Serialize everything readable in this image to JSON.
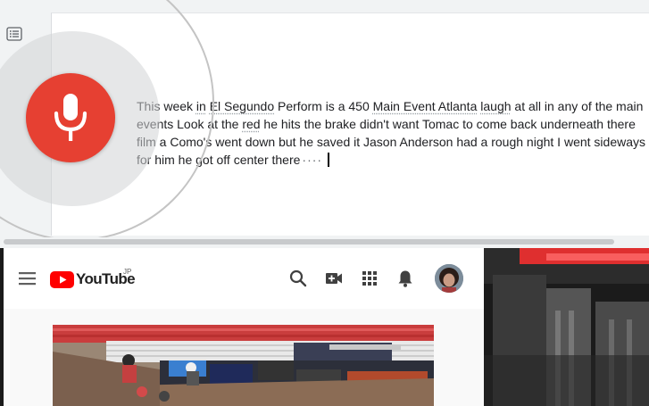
{
  "docs": {
    "transcript_lines": [
      {
        "parts": [
          {
            "text": "This week ",
            "u": false
          },
          {
            "text": "in",
            "u": true
          },
          {
            "text": " ",
            "u": false
          },
          {
            "text": "El Segundo",
            "u": true
          },
          {
            "text": " Perform is a 450 ",
            "u": false
          },
          {
            "text": "Main Event Atlanta",
            "u": true
          },
          {
            "text": " ",
            "u": false
          },
          {
            "text": "laugh",
            "u": true
          },
          {
            "text": " at all in any of the main",
            "u": false
          }
        ]
      },
      {
        "parts": [
          {
            "text": "events Look at the ",
            "u": false
          },
          {
            "text": "red",
            "u": true
          },
          {
            "text": " he hits the brake didn't want Tomac to come back underneath there",
            "u": false
          }
        ]
      },
      {
        "parts": [
          {
            "text": "film a Como's went down but he saved it Jason Anderson had a rough night I went sideways",
            "u": false
          }
        ]
      },
      {
        "parts": [
          {
            "text": "for him he got off center there",
            "u": false
          }
        ]
      }
    ],
    "interim_indicator": "····",
    "icons": {
      "outline": "document-outline-icon",
      "mic": "microphone-icon"
    },
    "colors": {
      "mic_button": "#e64032",
      "page_bg": "#f1f3f4"
    }
  },
  "youtube": {
    "logo_text": "YouTube",
    "region_code": "JP",
    "icons": {
      "menu": "hamburger-menu-icon",
      "search": "search-icon",
      "create": "video-camera-plus-icon",
      "apps": "apps-grid-icon",
      "notifications": "bell-icon",
      "avatar": "avatar"
    },
    "colors": {
      "brand_red": "#ff0000"
    },
    "thumbnail": {
      "banners": [
        "GoPro",
        "YAMAHA",
        "MONSTER"
      ]
    }
  }
}
